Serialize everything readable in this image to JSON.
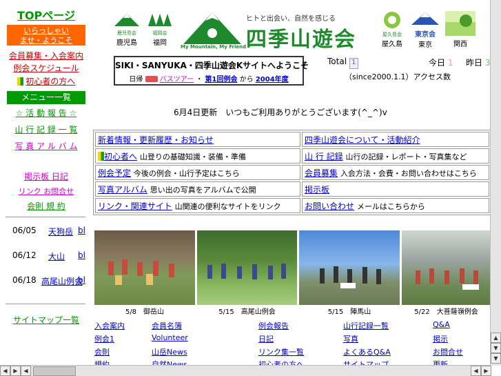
{
  "sidebar": {
    "top_label": "TOPページ",
    "orange_box": [
      "いらっしゃい",
      "ませ・ようこそ"
    ],
    "links": [
      "会員募集・入会案内",
      "例会スケジュール"
    ],
    "beginner_link": "初心者の方へ",
    "green_box": "メニュー一覧",
    "menu_rows": [
      "☆ 活 動 報 告 ☆",
      "山 行 記 録 一 覧",
      "写 真 ア ル バ ム",
      "掲示板   日記",
      "リンク   お問合せ",
      "会則   規 約"
    ],
    "schedule": [
      {
        "date": "06/05",
        "name": "天狗岳",
        "tag": "bl"
      },
      {
        "date": "06/12",
        "name": "大山",
        "tag": "bl"
      },
      {
        "date": "06/18",
        "name": "高尾山例会",
        "tag": "bl"
      }
    ],
    "bottom_link": "サイトマップ一覧"
  },
  "header": {
    "branches_left": [
      {
        "name": "鹿児島会",
        "label": "鹿児島"
      },
      {
        "name": "福岡会",
        "label": "福岡"
      }
    ],
    "tagline": "ヒトと出会い、自然を感じる",
    "brand_title": "四季山遊会",
    "brand_sub": "My Mountain, My Friend",
    "branches_right": [
      {
        "name": "屋久島会",
        "label": "屋久島"
      },
      {
        "name": "東京会",
        "label": "東京"
      },
      {
        "name": "",
        "label": "関西"
      }
    ],
    "notice_title": "SIKI・SANYUKA・四季山遊会Kサイトへようこそ",
    "notice_line_prefix": "日帰",
    "notice_links": [
      "バスツアー",
      "第1回例会",
      "2004年度"
    ],
    "notice_mid": "・",
    "notice_suffix": "から",
    "counters": [
      {
        "label": "Total",
        "value": "1"
      },
      {
        "label": "今日",
        "value": "1"
      },
      {
        "label": "昨日",
        "value": "3"
      }
    ],
    "since": "（since2000.1.1）アクセス数"
  },
  "announcement": "6月4日更新　いつもご利用ありがとうございます(^_^)v",
  "menu_table": [
    [
      {
        "link": "新着情報・更新履歴・お知らせ",
        "text": ""
      },
      {
        "link": "四季山遊会について・活動紹介",
        "text": ""
      }
    ],
    [
      {
        "link": "初心者へ",
        "text": "山登りの基礎知識・装備・準備",
        "beginner": true
      },
      {
        "link": "山 行 記録",
        "text": "山行の記録・レポート・写真集など"
      }
    ],
    [
      {
        "link": "例会予定",
        "text": "今後の例会・山行予定はこちら"
      },
      {
        "link": "会員募集",
        "text": "入会方法・会費・お問い合わせはこちら"
      }
    ],
    [
      {
        "link": "写真アルバム",
        "text": "思い出の写真をアルバムで公開"
      },
      {
        "link": "掲示板",
        "text": ""
      }
    ],
    [
      {
        "link": "リンク・関連サイト",
        "text": "山関連の便利なサイトをリンク"
      },
      {
        "link": "お問い合わせ",
        "text": "メールはこちらから"
      }
    ]
  ],
  "photos": [
    {
      "caption": "5/8　御岳山"
    },
    {
      "caption": "5/15　高尾山例会"
    },
    {
      "caption": "5/15　陣馬山"
    },
    {
      "caption": "5/22　大菩薩嶺例会"
    }
  ],
  "footer_links": [
    [
      "入会案内",
      "会員名簿",
      "例会報告",
      "山行記録一覧",
      "Q&A"
    ],
    [
      "例会1",
      "Volunteer",
      "日記",
      "写真",
      "掲示"
    ],
    [
      "会則",
      "山岳News",
      "リンク集一覧",
      "よくあるQ&A",
      "お問合せ"
    ],
    [
      "規約",
      "自然News",
      "初心者の方へ",
      "サイトマップ",
      "更新"
    ]
  ],
  "colors": {
    "orange": "#ff6600",
    "green": "#009900",
    "magenta": "#cc00cc",
    "link": "#0000cc"
  }
}
